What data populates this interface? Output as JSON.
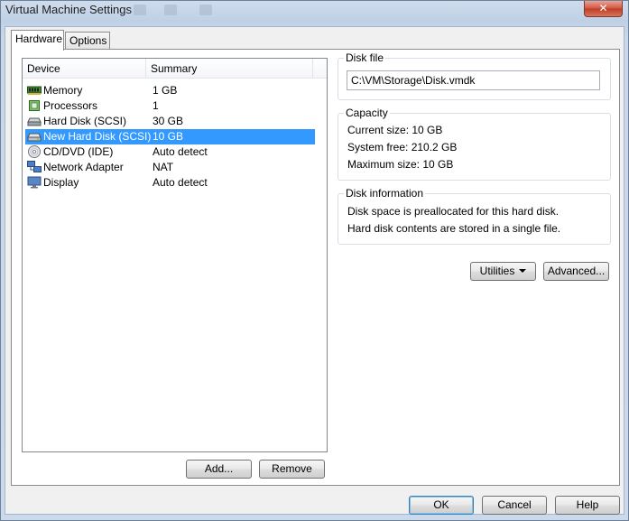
{
  "window": {
    "title": "Virtual Machine Settings",
    "close_label": "✕"
  },
  "tabs": [
    {
      "label": "Hardware",
      "active": true
    },
    {
      "label": "Options",
      "active": false
    }
  ],
  "device_list": {
    "columns": [
      "Device",
      "Summary"
    ],
    "rows": [
      {
        "icon": "memory-icon",
        "device": "Memory",
        "summary": "1 GB",
        "selected": false
      },
      {
        "icon": "processor-icon",
        "device": "Processors",
        "summary": "1",
        "selected": false
      },
      {
        "icon": "hard-disk-icon",
        "device": "Hard Disk (SCSI)",
        "summary": "30 GB",
        "selected": false
      },
      {
        "icon": "hard-disk-icon",
        "device": "New Hard Disk (SCSI)",
        "summary": "10 GB",
        "selected": true
      },
      {
        "icon": "cd-dvd-icon",
        "device": "CD/DVD (IDE)",
        "summary": "Auto detect",
        "selected": false
      },
      {
        "icon": "network-adapter-icon",
        "device": "Network Adapter",
        "summary": "NAT",
        "selected": false
      },
      {
        "icon": "display-icon",
        "device": "Display",
        "summary": "Auto detect",
        "selected": false
      }
    ],
    "add_label": "Add...",
    "remove_label": "Remove"
  },
  "disk_file": {
    "title": "Disk file",
    "value": "C:\\VM\\Storage\\Disk.vmdk"
  },
  "capacity": {
    "title": "Capacity",
    "current_size": "Current size:  10 GB",
    "system_free": "System free:  210.2 GB",
    "maximum_size": "Maximum size:  10 GB"
  },
  "disk_information": {
    "title": "Disk information",
    "line1": "Disk space is preallocated for this hard disk.",
    "line2": "Hard disk contents are stored in a single file."
  },
  "actions": {
    "utilities_label": "Utilities",
    "advanced_label": "Advanced..."
  },
  "footer": {
    "ok_label": "OK",
    "cancel_label": "Cancel",
    "help_label": "Help"
  },
  "colors": {
    "selection": "#3399ff",
    "window_frame": "#bfd0e6",
    "close_button": "#c03c25"
  }
}
